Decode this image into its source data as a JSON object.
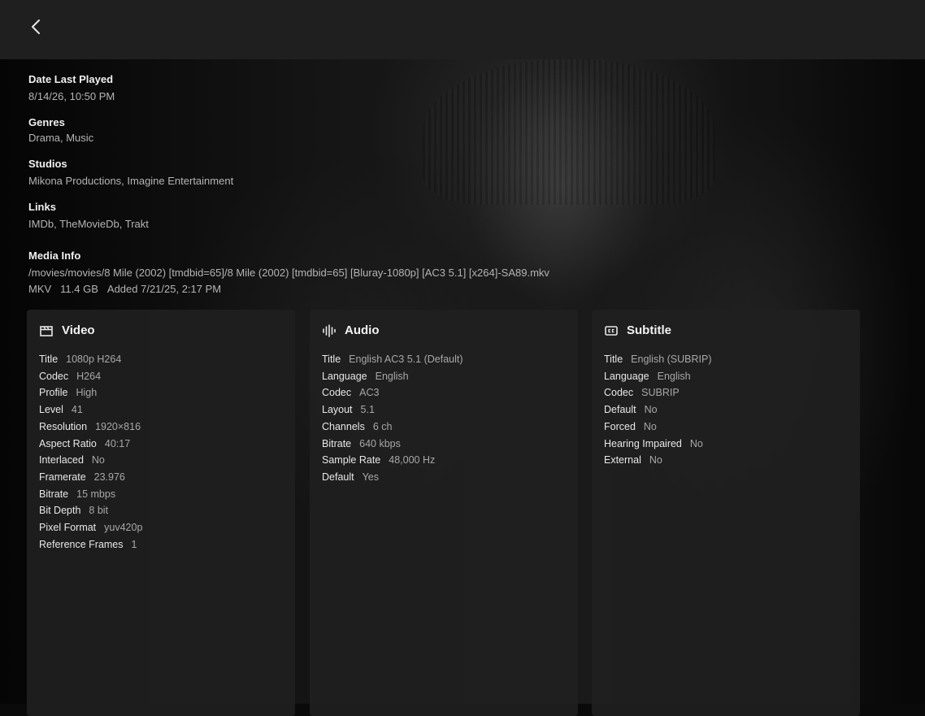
{
  "details": {
    "date_last_played": {
      "label": "Date Last Played",
      "value": "8/14/26, 10:50 PM"
    },
    "genres": {
      "label": "Genres",
      "value": "Drama, Music"
    },
    "studios": {
      "label": "Studios",
      "value": "Mikona Productions, Imagine Entertainment"
    },
    "links": {
      "label": "Links",
      "items": [
        "IMDb",
        "TheMovieDb",
        "Trakt"
      ]
    }
  },
  "media_info": {
    "label": "Media Info",
    "path": "/movies/movies/8 Mile (2002) [tmdbid=65]/8 Mile (2002) [tmdbid=65] [Bluray-1080p] [AC3 5.1] [x264]-SA89.mkv",
    "container": "MKV",
    "size": "11.4 GB",
    "added": "Added 7/21/25, 2:17 PM"
  },
  "streams": [
    {
      "title": "Video",
      "icon": "clapperboard-icon",
      "props": [
        {
          "k": "Title",
          "v": "1080p H264"
        },
        {
          "k": "Codec",
          "v": "H264"
        },
        {
          "k": "Profile",
          "v": "High"
        },
        {
          "k": "Level",
          "v": "41"
        },
        {
          "k": "Resolution",
          "v": "1920×816"
        },
        {
          "k": "Aspect Ratio",
          "v": "40:17"
        },
        {
          "k": "Interlaced",
          "v": "No"
        },
        {
          "k": "Framerate",
          "v": "23.976"
        },
        {
          "k": "Bitrate",
          "v": "15 mbps"
        },
        {
          "k": "Bit Depth",
          "v": "8 bit"
        },
        {
          "k": "Pixel Format",
          "v": "yuv420p"
        },
        {
          "k": "Reference Frames",
          "v": "1"
        }
      ]
    },
    {
      "title": "Audio",
      "icon": "audio-waveform-icon",
      "props": [
        {
          "k": "Title",
          "v": "English AC3 5.1 (Default)"
        },
        {
          "k": "Language",
          "v": "English"
        },
        {
          "k": "Codec",
          "v": "AC3"
        },
        {
          "k": "Layout",
          "v": "5.1"
        },
        {
          "k": "Channels",
          "v": "6 ch"
        },
        {
          "k": "Bitrate",
          "v": "640 kbps"
        },
        {
          "k": "Sample Rate",
          "v": "48,000 Hz"
        },
        {
          "k": "Default",
          "v": "Yes"
        }
      ]
    },
    {
      "title": "Subtitle",
      "icon": "closed-caption-icon",
      "props": [
        {
          "k": "Title",
          "v": "English (SUBRIP)"
        },
        {
          "k": "Language",
          "v": "English"
        },
        {
          "k": "Codec",
          "v": "SUBRIP"
        },
        {
          "k": "Default",
          "v": "No"
        },
        {
          "k": "Forced",
          "v": "No"
        },
        {
          "k": "Hearing Impaired",
          "v": "No"
        },
        {
          "k": "External",
          "v": "No"
        }
      ]
    }
  ]
}
